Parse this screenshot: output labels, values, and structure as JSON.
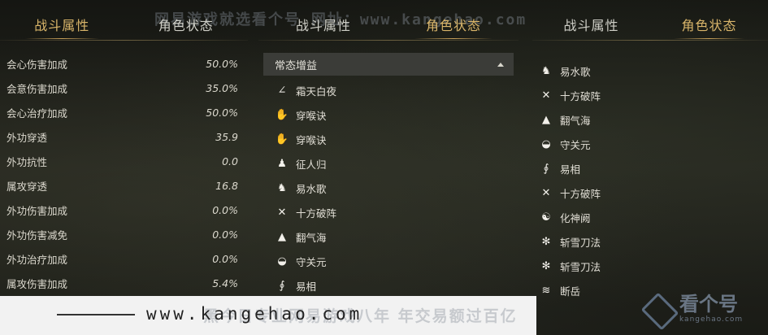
{
  "watermark_top": "网易游戏就选看个号 网址：www.kangehao.com",
  "panel_stats": {
    "tabs": [
      {
        "label": "战斗属性",
        "active": true
      },
      {
        "label": "角色状态",
        "active": false
      }
    ],
    "rows": [
      {
        "label": "会心伤害加成",
        "value": "50.0%"
      },
      {
        "label": "会意伤害加成",
        "value": "35.0%"
      },
      {
        "label": "会心治疗加成",
        "value": "50.0%"
      },
      {
        "label": "外功穿透",
        "value": "35.9"
      },
      {
        "label": "外功抗性",
        "value": "0.0"
      },
      {
        "label": "属攻穿透",
        "value": "16.8"
      },
      {
        "label": "外功伤害加成",
        "value": "0.0%"
      },
      {
        "label": "外功伤害减免",
        "value": "0.0%"
      },
      {
        "label": "外功治疗加成",
        "value": "0.0%"
      },
      {
        "label": "属攻伤害加成",
        "value": "5.4%"
      }
    ]
  },
  "panel_buffs_1": {
    "tabs": [
      {
        "label": "战斗属性",
        "active": false
      },
      {
        "label": "角色状态",
        "active": true
      }
    ],
    "dropdown": {
      "selected": "常态增益",
      "icon": "caret-up-icon"
    },
    "buffs": [
      {
        "label": "霜天白夜",
        "icon": "slash-icon",
        "glyph": "∠"
      },
      {
        "label": "穿喉诀",
        "icon": "hand-icon",
        "glyph": "✋"
      },
      {
        "label": "穿喉诀",
        "icon": "hand-icon",
        "glyph": "✋"
      },
      {
        "label": "征人归",
        "icon": "figure-icon",
        "glyph": "♟"
      },
      {
        "label": "易水歌",
        "icon": "horse-icon",
        "glyph": "♞"
      },
      {
        "label": "十方破阵",
        "icon": "crossed-swords-icon",
        "glyph": "✕"
      },
      {
        "label": "翻气海",
        "icon": "mountain-icon",
        "glyph": "▲"
      },
      {
        "label": "守关元",
        "icon": "shield-icon",
        "glyph": "◒"
      },
      {
        "label": "易相",
        "icon": "swirl-icon",
        "glyph": "∮"
      }
    ]
  },
  "panel_buffs_2": {
    "tabs": [
      {
        "label": "战斗属性",
        "active": false
      },
      {
        "label": "角色状态",
        "active": true
      }
    ],
    "buffs": [
      {
        "label": "易水歌",
        "icon": "horse-icon",
        "glyph": "♞"
      },
      {
        "label": "十方破阵",
        "icon": "crossed-swords-icon",
        "glyph": "✕"
      },
      {
        "label": "翻气海",
        "icon": "mountain-icon",
        "glyph": "▲"
      },
      {
        "label": "守关元",
        "icon": "shield-icon",
        "glyph": "◒"
      },
      {
        "label": "易相",
        "icon": "swirl-icon",
        "glyph": "∮"
      },
      {
        "label": "十方破阵",
        "icon": "crossed-swords-icon",
        "glyph": "✕"
      },
      {
        "label": "化神阙",
        "icon": "orb-icon",
        "glyph": "☯"
      },
      {
        "label": "斩雪刀法",
        "icon": "snowflake-icon",
        "glyph": "✻"
      },
      {
        "label": "斩雪刀法",
        "icon": "snowflake-icon",
        "glyph": "✻"
      },
      {
        "label": "断岳",
        "icon": "wave-icon",
        "glyph": "≋"
      }
    ]
  },
  "footer": {
    "url": "www.kangehao.com",
    "faded_text": "黑今日专业网易游戏八年 年交易额过百亿",
    "logo_cn": "看个号",
    "logo_en": "kangehao.com"
  }
}
